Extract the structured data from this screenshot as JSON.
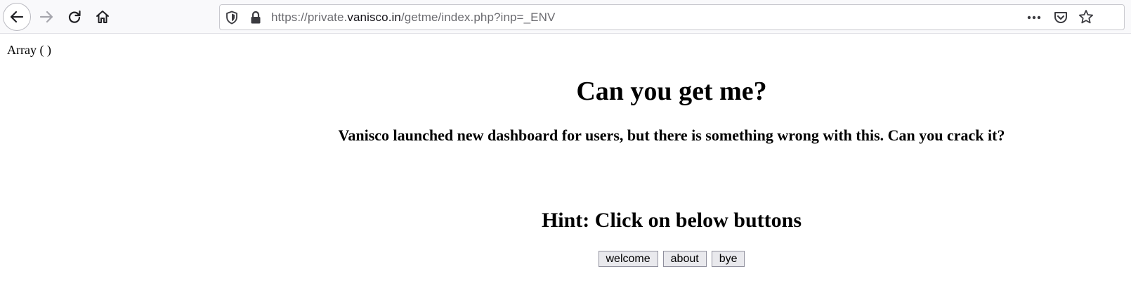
{
  "browser": {
    "url": {
      "prefix": "https://private.",
      "host": "vanisco.in",
      "suffix": "/getme/index.php?inp=_ENV"
    },
    "icons": {
      "back": "back-arrow-icon",
      "forward": "forward-arrow-icon",
      "reload": "reload-icon",
      "home": "home-icon",
      "tracking": "shield-icon",
      "secure": "lock-icon",
      "more": "more-dots-icon",
      "pocket": "pocket-icon",
      "bookmark": "star-icon"
    }
  },
  "page": {
    "array_output": "Array ( )",
    "title": "Can you get me?",
    "description": "Vanisco launched new dashboard for users, but there is something wrong with this. Can you crack it?",
    "hint": "Hint: Click on below buttons",
    "buttons": [
      "welcome",
      "about",
      "bye"
    ]
  }
}
